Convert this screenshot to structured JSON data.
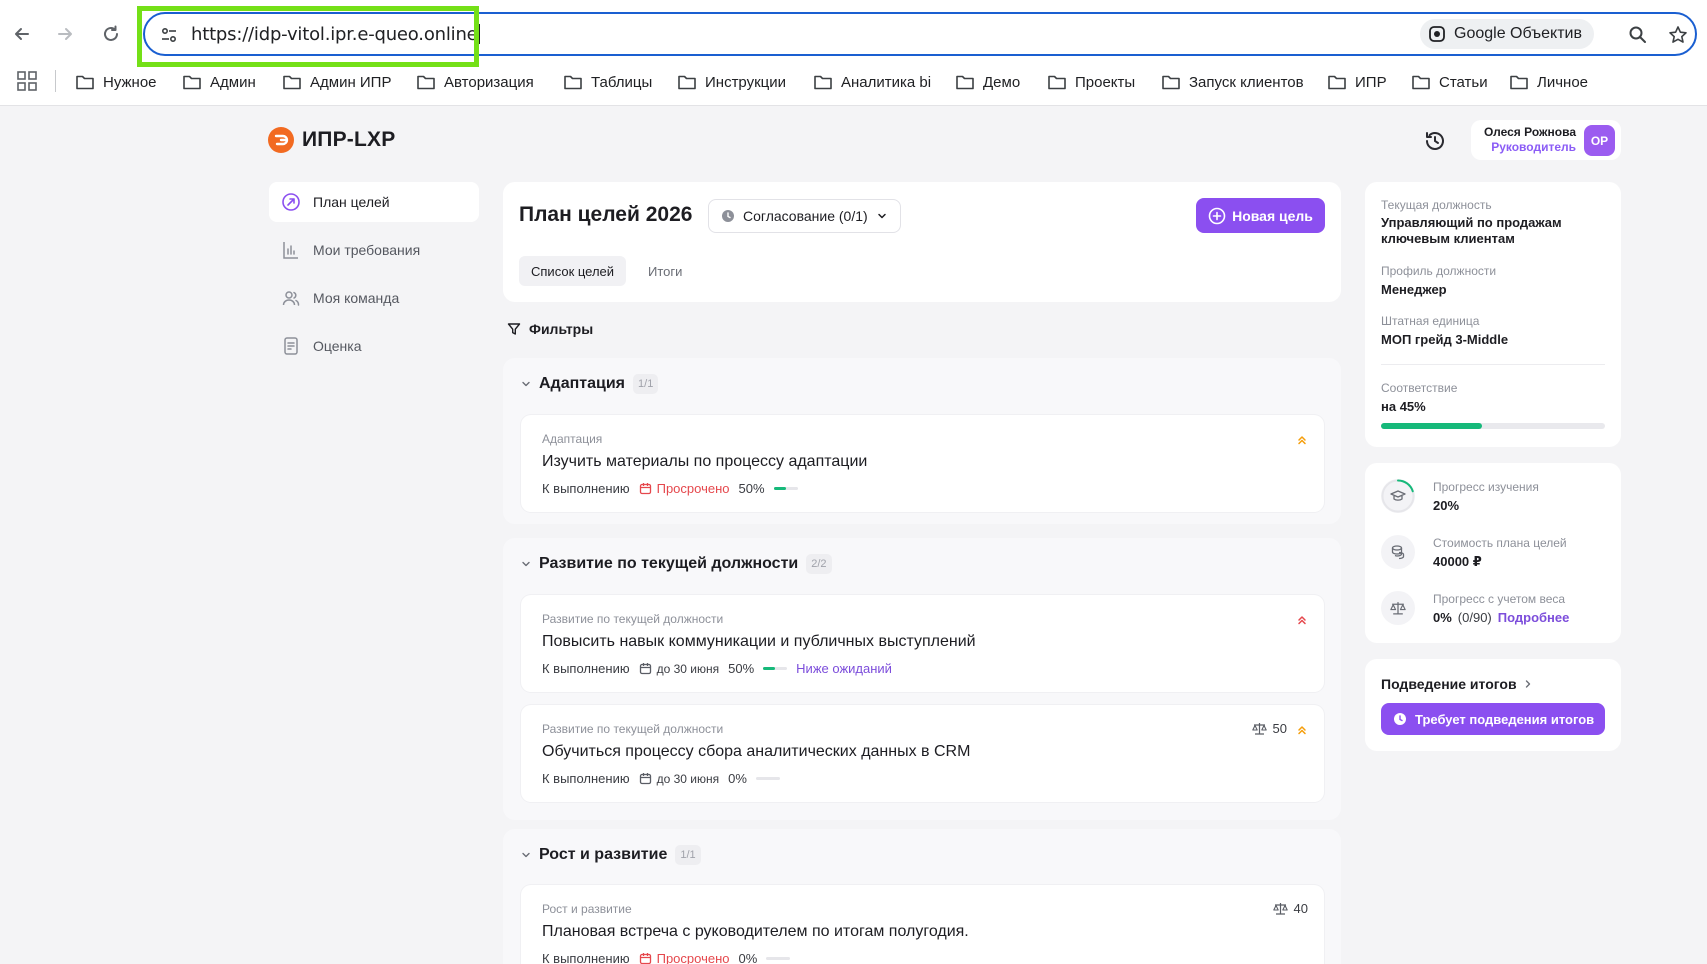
{
  "browser": {
    "url": "https://idp-vitol.ipr.e-queo.online",
    "lens_label": "Google Объектив",
    "bookmarks": [
      "Нужное",
      "Админ",
      "Админ ИПР",
      "Авторизация",
      "Таблицы",
      "Инструкции",
      "Аналитика bi",
      "Демо",
      "Проекты",
      "Запуск клиентов",
      "ИПР",
      "Статьи",
      "Личное"
    ]
  },
  "app": {
    "logo": "ИПР-LXP",
    "user": {
      "name": "Олеся Рожнова",
      "role": "Руководитель",
      "initials": "ОР"
    }
  },
  "sidebar": {
    "items": [
      {
        "label": "План целей",
        "active": true
      },
      {
        "label": "Мои требования",
        "active": false
      },
      {
        "label": "Моя команда",
        "active": false
      },
      {
        "label": "Оценка",
        "active": false
      }
    ]
  },
  "header": {
    "title": "План целей 2026",
    "status": "Согласование (0/1)",
    "new_goal": "Новая цель",
    "tabs": [
      "Список целей",
      "Итоги"
    ],
    "filters": "Фильтры"
  },
  "groups": [
    {
      "name": "Адаптация",
      "count": "1/1",
      "goals": [
        {
          "category": "Адаптация",
          "title": "Изучить материалы по процессу адаптации",
          "status": "К выполнению",
          "overdue": "Просрочено",
          "progress_label": "50%",
          "progress": 0.5,
          "priority": "medium"
        }
      ]
    },
    {
      "name": "Развитие по текущей должности",
      "count": "2/2",
      "goals": [
        {
          "category": "Развитие по текущей должности",
          "title": "Повысить навык коммуникации и публичных выступлений",
          "status": "К выполнению",
          "deadline": "до 30 июня",
          "progress_label": "50%",
          "progress": 0.5,
          "assessment": "Ниже ожиданий",
          "priority": "high"
        },
        {
          "category": "Развитие по текущей должности",
          "title": "Обучиться процессу сбора аналитических данных в CRM",
          "status": "К выполнению",
          "deadline": "до 30 июня",
          "progress_label": "0%",
          "progress": 0,
          "weight": "50",
          "priority": "medium"
        }
      ]
    },
    {
      "name": "Рост и развитие",
      "count": "1/1",
      "goals": [
        {
          "category": "Рост и развитие",
          "title": "Плановая встреча с руководителем по итогам полугодия.",
          "status": "К выполнению",
          "overdue": "Просрочено",
          "progress_label": "0%",
          "progress": 0,
          "weight": "40"
        }
      ]
    }
  ],
  "profile": {
    "current_position_label": "Текущая должность",
    "current_position": "Управляющий по продажам ключевым клиентам",
    "job_profile_label": "Профиль должности",
    "job_profile": "Менеджер",
    "staff_unit_label": "Штатная единица",
    "staff_unit": "МОП грейд 3-Middle",
    "match_label": "Соответствие",
    "match_value": "на 45%",
    "match": 0.45
  },
  "stats": {
    "learning_label": "Прогресс изучения",
    "learning_value": "20%",
    "learning": 0.2,
    "cost_label": "Стоимость плана целей",
    "cost_value": "40000 ₽",
    "weighted_label": "Прогресс с учетом веса",
    "weighted_value": "0%",
    "weighted_extra": "(0/90)",
    "weighted_link": "Подробнее"
  },
  "summary": {
    "title": "Подведение итогов",
    "button": "Требует подведения итогов"
  },
  "colors": {
    "accent": "#8b4ff0",
    "success": "#16b97a",
    "danger": "#e5484d",
    "logo": "#f26a21"
  }
}
